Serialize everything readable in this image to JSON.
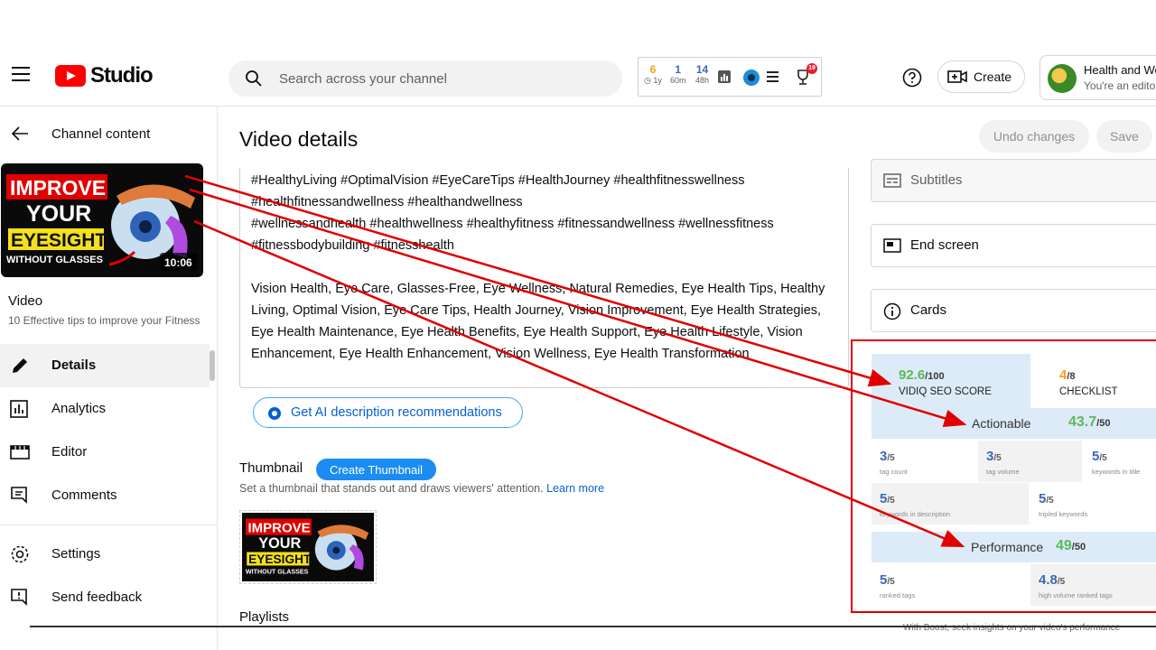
{
  "header": {
    "logo_text": "Studio",
    "search_placeholder": "Search across your channel",
    "ext_stats": [
      {
        "value": "6",
        "sub": "1y",
        "color": "#f0a31a"
      },
      {
        "value": "1",
        "sub": "60m",
        "color": "#3c68b8"
      },
      {
        "value": "14",
        "sub": "48h",
        "color": "#3c68b8"
      }
    ],
    "notification_count": "19",
    "create_label": "Create",
    "account_name": "Health and We",
    "account_role": "You're an edito"
  },
  "sidebar": {
    "back_label": "Channel content",
    "video_label": "Video",
    "video_title": "10 Effective tips to improve your Fitness",
    "thumbnail": {
      "line1": "IMPROVE",
      "line2": "YOUR",
      "line3": "EYESIGHT",
      "line4": "WITHOUT GLASSES",
      "duration": "10:06"
    },
    "items": [
      {
        "label": "Details",
        "icon": "pencil-icon",
        "active": true
      },
      {
        "label": "Analytics",
        "icon": "analytics-icon"
      },
      {
        "label": "Editor",
        "icon": "editor-icon"
      },
      {
        "label": "Comments",
        "icon": "comments-icon"
      },
      {
        "label": "Settings",
        "icon": "gear-icon"
      },
      {
        "label": "Send feedback",
        "icon": "feedback-icon"
      }
    ]
  },
  "main": {
    "title": "Video details",
    "undo_label": "Undo changes",
    "save_label": "Save",
    "description": "#HealthyLiving #OptimalVision #EyeCareTips #HealthJourney #healthfitnesswellness\n#healthfitnessandwellness #healthandwellness\n#wellnessandhealth #healthwellness #healthyfitness #fitnessandwellness #wellnessfitness\n#fitnessbodybuilding #fitnesshealth\n\nVision Health, Eye Care, Glasses-Free, Eye Wellness, Natural Remedies, Eye Health Tips, Healthy Living, Optimal Vision, Eye Care Tips, Health Journey, Vision Improvement, Eye Health Strategies, Eye Health Maintenance, Eye Health Benefits, Eye Health Support, Eye Health Lifestyle, Vision Enhancement, Eye Health Enhancement, Vision Wellness, Eye Health Transformation",
    "ai_button": "Get AI description recommendations",
    "thumbnail_label": "Thumbnail",
    "create_thumbnail": "Create Thumbnail",
    "thumbnail_hint": "Set a thumbnail that stands out and draws viewers' attention.",
    "learn_more": "Learn more",
    "playlists_label": "Playlists"
  },
  "right": {
    "subtitles": "Subtitles",
    "end_screen": "End screen",
    "cards": "Cards"
  },
  "vidiq": {
    "seo_score": "92.6",
    "seo_max": "/100",
    "seo_caption": "VIDIQ SEO SCORE",
    "checklist_score": "4",
    "checklist_max": "/8",
    "checklist_caption": "CHECKLIST",
    "actionable_label": "Actionable",
    "actionable_score": "43.7",
    "actionable_max": "/50",
    "actionable_metrics": [
      {
        "value": "3",
        "max": "/5",
        "label": "tag count"
      },
      {
        "value": "3",
        "max": "/5",
        "label": "tag volume"
      },
      {
        "value": "5",
        "max": "/5",
        "label": "keywords in title"
      },
      {
        "value": "5",
        "max": "/5",
        "label": "keywords in description"
      },
      {
        "value": "5",
        "max": "/5",
        "label": "tripled keywords"
      }
    ],
    "performance_label": "Performance",
    "performance_score": "49",
    "performance_max": "/50",
    "performance_metrics": [
      {
        "value": "5",
        "max": "/5",
        "label": "ranked tags"
      },
      {
        "value": "4.8",
        "max": "/5",
        "label": "high volume ranked tags"
      }
    ],
    "footer_fragment": "With Boost, seek insights on your video's performance"
  },
  "colors": {
    "brand_red": "#ff0000",
    "accent_blue": "#065fd4",
    "vidiq_green": "#5cb85c",
    "vidiq_blue": "#3c68b8",
    "annotation_red": "#e00000"
  }
}
